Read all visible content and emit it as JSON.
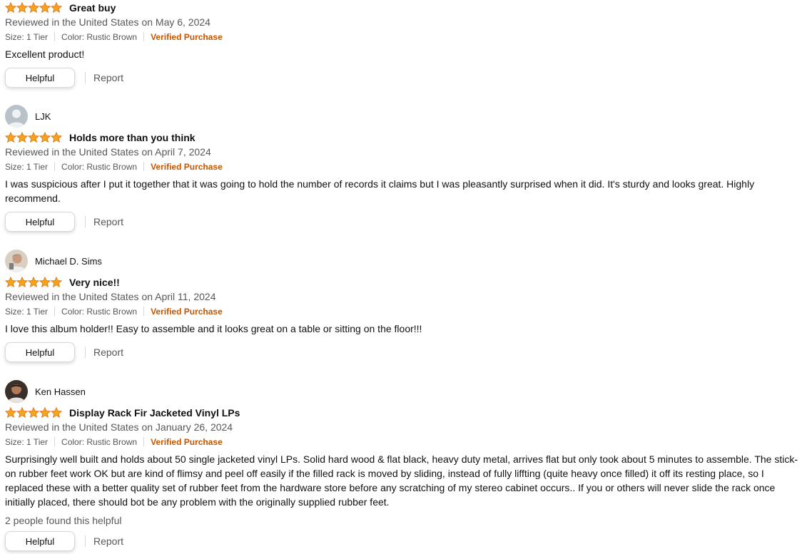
{
  "colors": {
    "star": "#f7a41d",
    "star_outline": "#de7921",
    "verified": "#c45500",
    "muted_text": "#565959",
    "text": "#0f1111"
  },
  "labels": {
    "helpful_button": "Helpful",
    "report_link": "Report"
  },
  "reviews": [
    {
      "reviewer": "",
      "rating": 5,
      "title": "Great buy",
      "reviewed_on": "Reviewed in the United States on May 6, 2024",
      "size": "Size: 1 Tier",
      "color": "Color: Rustic Brown",
      "verified": "Verified Purchase",
      "body": "Excellent product!",
      "helpful_count": ""
    },
    {
      "reviewer": "LJK",
      "rating": 5,
      "title": "Holds more than you think",
      "reviewed_on": "Reviewed in the United States on April 7, 2024",
      "size": "Size: 1 Tier",
      "color": "Color: Rustic Brown",
      "verified": "Verified Purchase",
      "body": "I was suspicious after I put it together that it was going to hold the number of records it claims but I was pleasantly surprised when it did. It's sturdy and looks great. Highly recommend.",
      "helpful_count": ""
    },
    {
      "reviewer": "Michael D. Sims",
      "rating": 5,
      "title": "Very nice!!",
      "reviewed_on": "Reviewed in the United States on April 11, 2024",
      "size": "Size: 1 Tier",
      "color": "Color: Rustic Brown",
      "verified": "Verified Purchase",
      "body": "I love this album holder!! Easy to assemble and it looks great on a table or sitting on the floor!!!",
      "helpful_count": ""
    },
    {
      "reviewer": "Ken Hassen",
      "rating": 5,
      "title": "Display Rack Fir Jacketed Vinyl LPs",
      "reviewed_on": "Reviewed in the United States on January 26, 2024",
      "size": "Size: 1 Tier",
      "color": "Color: Rustic Brown",
      "verified": "Verified Purchase",
      "body": "Surprisingly well built and holds about 50 single jacketed vinyl LPs. Solid hard wood & flat black, heavy duty metal, arrives flat but only took about 5 minutes to assemble. The stick-on rubber feet work OK but are kind of flimsy and peel off easily if the filled rack is moved by sliding, instead of fully liffting (quite heavy once filled) it off its resting place, so I replaced these with a better quality set of rubber feet from the hardware store before any scratching of my stereo cabinet occurs.. If you or others will never slide the rack once initially placed, there should bot be any problem with the originally supplied rubber feet.",
      "helpful_count": "2 people found this helpful"
    }
  ]
}
